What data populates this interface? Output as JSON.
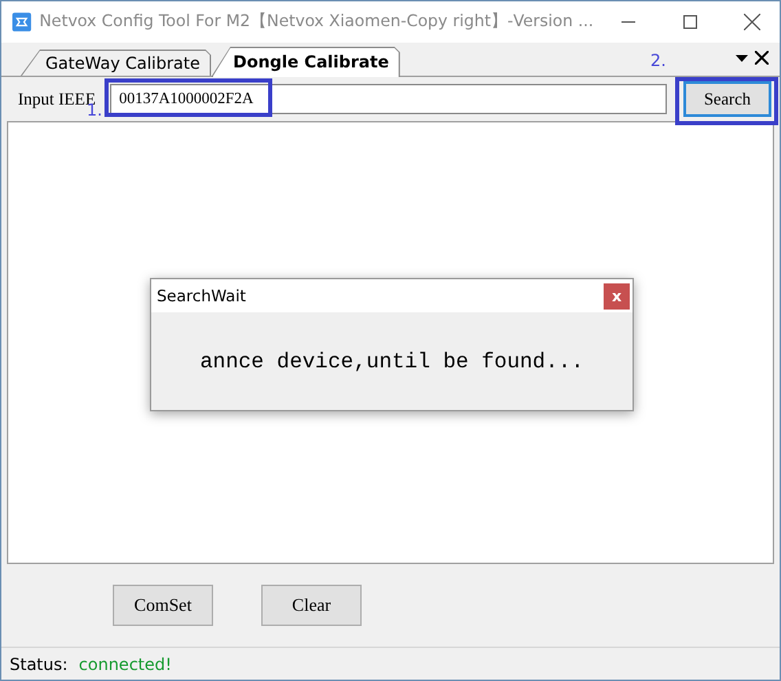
{
  "window": {
    "title": "Netvox Config Tool For M2【Netvox Xiaomen-Copy right】-Version ..."
  },
  "tabs": [
    {
      "label": "GateWay Calibrate",
      "selected": false
    },
    {
      "label": "Dongle Calibrate",
      "selected": true
    }
  ],
  "ieee": {
    "label": "Input IEEE",
    "value": "00137A1000002F2A"
  },
  "search_button": "Search",
  "annotations": [
    {
      "label": "1."
    },
    {
      "label": "2."
    }
  ],
  "dialog": {
    "title": "SearchWait",
    "close": "x",
    "message": "annce device,until be found..."
  },
  "buttons": [
    "ComSet",
    "Clear"
  ],
  "status": {
    "label": "Status:",
    "value": "connected!"
  }
}
